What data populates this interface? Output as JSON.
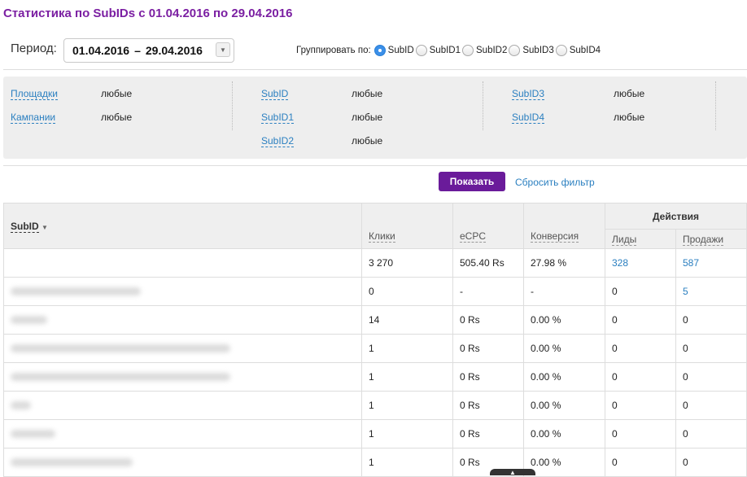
{
  "page_title": "Статистика по SubIDs с 01.04.2016 по 29.04.2016",
  "period": {
    "label": "Период:",
    "start": "01.04.2016",
    "separator": "–",
    "end": "29.04.2016",
    "dropdown_icon": "chevron-down-icon"
  },
  "group_by": {
    "label": "Группировать по:",
    "options": [
      "SubID",
      "SubID1",
      "SubID2",
      "SubID3",
      "SubID4"
    ],
    "selected": "SubID"
  },
  "filters": {
    "items": [
      {
        "label": "Площадки",
        "value": "любые"
      },
      {
        "label": "Кампании",
        "value": "любые"
      },
      {
        "label": "SubID",
        "value": "любые"
      },
      {
        "label": "SubID1",
        "value": "любые"
      },
      {
        "label": "SubID2",
        "value": "любые"
      },
      {
        "label": "SubID3",
        "value": "любые"
      },
      {
        "label": "SubID4",
        "value": "любые"
      }
    ]
  },
  "actions": {
    "show_label": "Показать",
    "reset_label": "Сбросить фильтр"
  },
  "table": {
    "headers": {
      "subid": "SubID",
      "sort_icon": "sort-down-icon",
      "clicks": "Клики",
      "ecpc": "eCPC",
      "conversion": "Конверсия",
      "actions": "Действия",
      "leads": "Лиды",
      "sales": "Продажи"
    },
    "rows": [
      {
        "subid": "",
        "clicks": "3 270",
        "ecpc": "505.40 Rs",
        "conversion": "27.98 %",
        "leads": "328",
        "sales": "587"
      },
      {
        "subid": "",
        "clicks": "0",
        "ecpc": "-",
        "conversion": "-",
        "leads": "0",
        "sales": "5"
      },
      {
        "subid": "",
        "clicks": "14",
        "ecpc": "0 Rs",
        "conversion": "0.00 %",
        "leads": "0",
        "sales": "0"
      },
      {
        "subid": "",
        "clicks": "1",
        "ecpc": "0 Rs",
        "conversion": "0.00 %",
        "leads": "0",
        "sales": "0"
      },
      {
        "subid": "",
        "clicks": "1",
        "ecpc": "0 Rs",
        "conversion": "0.00 %",
        "leads": "0",
        "sales": "0"
      },
      {
        "subid": "",
        "clicks": "1",
        "ecpc": "0 Rs",
        "conversion": "0.00 %",
        "leads": "0",
        "sales": "0"
      },
      {
        "subid": "",
        "clicks": "1",
        "ecpc": "0 Rs",
        "conversion": "0.00 %",
        "leads": "0",
        "sales": "0"
      },
      {
        "subid": "",
        "clicks": "1",
        "ecpc": "0 Rs",
        "conversion": "0.00 %",
        "leads": "0",
        "sales": "0"
      }
    ]
  },
  "colors": {
    "title": "#7b1fa2",
    "button": "#6a1b9a",
    "link": "#2a7fc0"
  }
}
